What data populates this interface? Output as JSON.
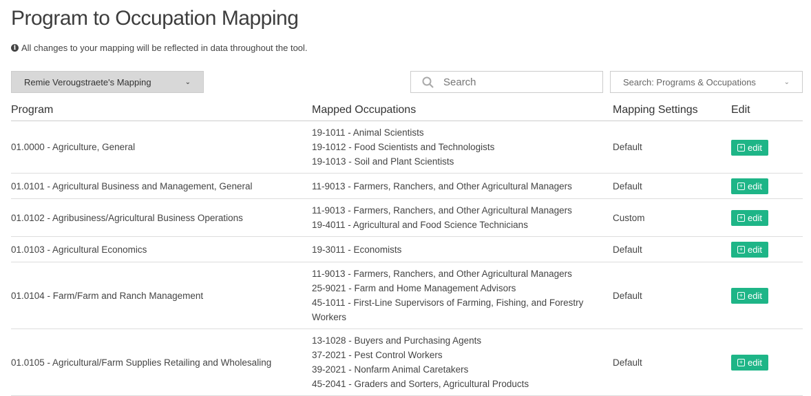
{
  "title": "Program to Occupation Mapping",
  "info": "All changes to your mapping will be reflected in data throughout the tool.",
  "mapping_select": "Remie Verougstraete's Mapping",
  "search": {
    "placeholder": "Search"
  },
  "search_scope": "Search: Programs & Occupations",
  "columns": [
    "Program",
    "Mapped Occupations",
    "Mapping Settings",
    "Edit"
  ],
  "edit_label": "edit",
  "rows": [
    {
      "program": "01.0000 - Agriculture, General",
      "occupations": [
        "19-1011 - Animal Scientists",
        "19-1012 - Food Scientists and Technologists",
        "19-1013 - Soil and Plant Scientists"
      ],
      "setting": "Default"
    },
    {
      "program": "01.0101 - Agricultural Business and Management, General",
      "occupations": [
        "11-9013 - Farmers, Ranchers, and Other Agricultural Managers"
      ],
      "setting": "Default"
    },
    {
      "program": "01.0102 - Agribusiness/Agricultural Business Operations",
      "occupations": [
        "11-9013 - Farmers, Ranchers, and Other Agricultural Managers",
        "19-4011 - Agricultural and Food Science Technicians"
      ],
      "setting": "Custom"
    },
    {
      "program": "01.0103 - Agricultural Economics",
      "occupations": [
        "19-3011 - Economists"
      ],
      "setting": "Default"
    },
    {
      "program": "01.0104 - Farm/Farm and Ranch Management",
      "occupations": [
        "11-9013 - Farmers, Ranchers, and Other Agricultural Managers",
        "25-9021 - Farm and Home Management Advisors",
        "45-1011 - First-Line Supervisors of Farming, Fishing, and Forestry Workers"
      ],
      "setting": "Default"
    },
    {
      "program": "01.0105 - Agricultural/Farm Supplies Retailing and Wholesaling",
      "occupations": [
        "13-1028 - Buyers and Purchasing Agents",
        "37-2021 - Pest Control Workers",
        "39-2021 - Nonfarm Animal Caretakers",
        "45-2041 - Graders and Sorters, Agricultural Products"
      ],
      "setting": "Default"
    }
  ]
}
